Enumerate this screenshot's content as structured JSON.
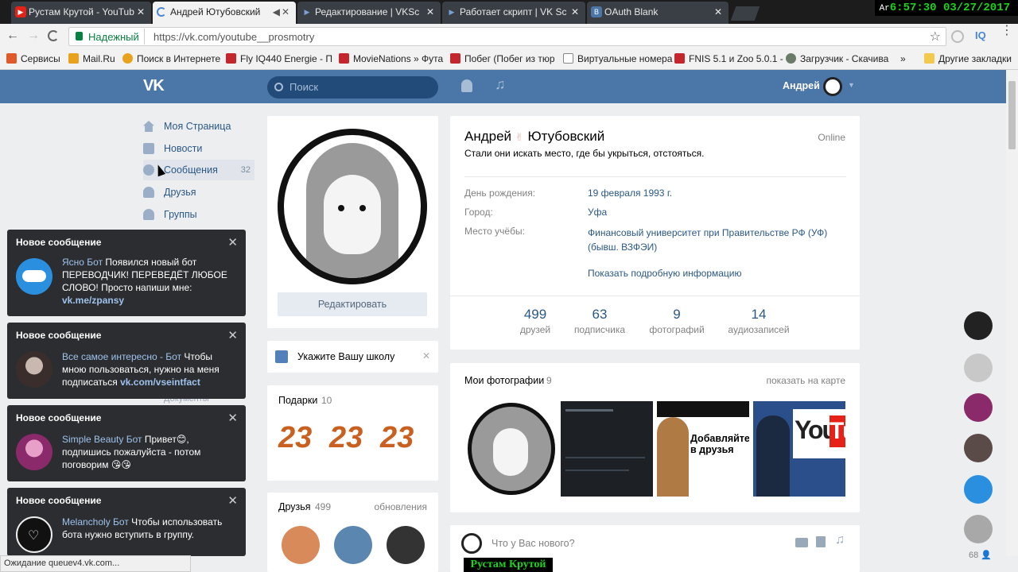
{
  "browser": {
    "tabs": [
      {
        "title": "Рустам Крутой - YouTub",
        "icon": "youtube-icon",
        "active": false
      },
      {
        "title": "Андрей Ютубовский",
        "icon": "loading-icon",
        "active": true
      },
      {
        "title": "Редактирование | VKSc",
        "icon": "play-icon",
        "active": false
      },
      {
        "title": "Работает скрипт | VK Sc",
        "icon": "play-icon",
        "active": false
      },
      {
        "title": "OAuth Blank",
        "icon": "vk-icon",
        "active": false
      }
    ],
    "clock": "6:57:30  03/27/2017",
    "clock_prefix": "Ar",
    "secure_label": "Надежный",
    "url": "https://vk.com/youtube__prosmotry",
    "ext_label": "IQ",
    "bookmarks": [
      {
        "label": "Сервисы",
        "icon": "apps-icon",
        "color": "#e0592a"
      },
      {
        "label": "Mail.Ru",
        "icon": "mailru-icon",
        "color": "#e9a21b"
      },
      {
        "label": "Поиск в Интернете",
        "icon": "search-icon",
        "color": "#e9a21b"
      },
      {
        "label": "Fly IQ440 Energie - П",
        "icon": "bookmark-icon",
        "color": "#c4262e"
      },
      {
        "label": "MovieNations » Фута",
        "icon": "bookmark-icon",
        "color": "#c4262e"
      },
      {
        "label": "Побег (Побег из тюр",
        "icon": "bookmark-icon",
        "color": "#c4262e"
      },
      {
        "label": "Виртуальные номера",
        "icon": "page-icon",
        "color": "#888888"
      },
      {
        "label": "FNIS 5.1 и Zoo 5.0.1 -",
        "icon": "bookmark-icon",
        "color": "#c4262e"
      },
      {
        "label": "Загрузчик - Скачива",
        "icon": "globe-icon",
        "color": "#6b7b6a"
      }
    ],
    "bookmarks_more": "»",
    "other_bookmarks": "Другие закладки",
    "status": "Ожидание queuev4.vk.com..."
  },
  "vk": {
    "logo": "VK",
    "search_placeholder": "Поиск",
    "user_name": "Андрей",
    "menu": [
      {
        "label": "Моя Страница",
        "icon": "home-icon",
        "count": ""
      },
      {
        "label": "Новости",
        "icon": "news-icon",
        "count": ""
      },
      {
        "label": "Сообщения",
        "icon": "messages-icon",
        "count": "32"
      },
      {
        "label": "Друзья",
        "icon": "friends-icon",
        "count": ""
      },
      {
        "label": "Группы",
        "icon": "groups-icon",
        "count": ""
      }
    ],
    "hidden_menu_fragment": "Документы",
    "notifications": [
      {
        "header": "Новое сообщение",
        "sender": "Ясно Бот",
        "text": " Появился новый бот ПЕРЕВОДЧИК! ПЕРЕВЕДЁТ ЛЮБОЕ СЛОВО! Просто напиши мне: ",
        "link": "vk.me/zpansy",
        "avatar_color": "#2b8fe0"
      },
      {
        "header": "Новое сообщение",
        "sender": "Все самое интересно - Бот",
        "text": " Чтобы мною пользоваться, нужно на меня подписаться ",
        "link": "vk.com/vseintfact",
        "avatar_color": "#5a4a48"
      },
      {
        "header": "Новое сообщение",
        "sender": "Simple Beauty Бот",
        "text": " Привет😊, подпишись пожалуйста - потом поговорим 😘😘",
        "link": "",
        "avatar_color": "#b04a8a"
      },
      {
        "header": "Новое сообщение",
        "sender": "Melancholy Бот",
        "text": " Чтобы использовать бота нужно вступить в группу.",
        "link": "",
        "avatar_color": "#222222"
      }
    ],
    "edit_button": "Редактировать",
    "school_prompt": "Укажите Вашу школу",
    "gifts_label": "Подарки",
    "gifts_count": "10",
    "gift_text": "23",
    "friends_label": "Друзья",
    "friends_count": "499",
    "friends_updates": "обновления",
    "profile": {
      "name": "Андрей",
      "surname": "Ютубовский",
      "online": "Online",
      "status": "Стали они искать место, где бы укрыться, отстояться.",
      "fields": [
        {
          "label": "День рождения:",
          "value": "19 февраля 1993 г."
        },
        {
          "label": "Город:",
          "value": "Уфа"
        },
        {
          "label": "Место учёбы:",
          "value": "Финансовый университет при Правительстве РФ (УФ) (бывш. ВЗФЭИ)"
        }
      ],
      "show_more": "Показать подробную информацию",
      "counters": [
        {
          "value": "499",
          "label": "друзей"
        },
        {
          "value": "63",
          "label": "подписчика"
        },
        {
          "value": "9",
          "label": "фотографий"
        },
        {
          "value": "14",
          "label": "аудиозаписей"
        }
      ]
    },
    "photos_label": "Мои фотографии",
    "photos_count": "9",
    "show_on_map": "показать на карте",
    "photo_texts": [
      "Добавляйте",
      "в друзья",
      "You",
      "Tu"
    ],
    "post_placeholder": "Что у Вас нового?",
    "right_counter": "68"
  },
  "watermark": "Рустам Крутой"
}
